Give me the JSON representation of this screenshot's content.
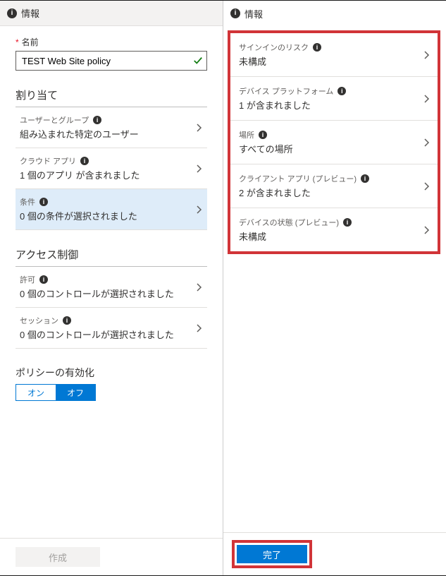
{
  "left": {
    "tab": "情報",
    "name_label": "名前",
    "name_value": "TEST Web Site policy",
    "sections": {
      "assignment": {
        "title": "割り当て",
        "items": [
          {
            "label": "ユーザーとグループ",
            "value": "組み込まれた特定のユーザー"
          },
          {
            "label": "クラウド アプリ",
            "value": "1 個のアプリ が含まれました"
          },
          {
            "label": "条件",
            "value": "0 個の条件が選択されました",
            "selected": true
          }
        ]
      },
      "access": {
        "title": "アクセス制御",
        "items": [
          {
            "label": "許可",
            "value": "0 個のコントロールが選択されました"
          },
          {
            "label": "セッション",
            "value": "0 個のコントロールが選択されました"
          }
        ]
      }
    },
    "enable": {
      "title": "ポリシーの有効化",
      "on": "オン",
      "off": "オフ"
    },
    "create_button": "作成"
  },
  "right": {
    "tab": "情報",
    "items": [
      {
        "label": "サインインのリスク",
        "value": "未構成"
      },
      {
        "label": "デバイス プラットフォーム",
        "value": "1 が含まれました"
      },
      {
        "label": "場所",
        "value": "すべての場所"
      },
      {
        "label": "クライアント アプリ (プレビュー)",
        "value": "2 が含まれました"
      },
      {
        "label": "デバイスの状態 (プレビュー)",
        "value": "未構成"
      }
    ],
    "done_button": "完了"
  }
}
